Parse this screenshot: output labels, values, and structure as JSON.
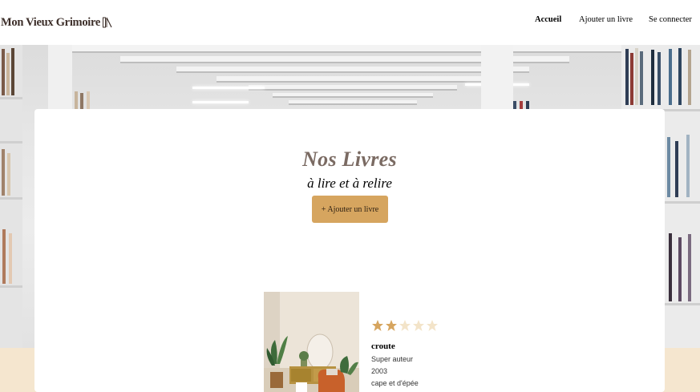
{
  "header": {
    "logo_text": "Mon Vieux Grimoire",
    "nav": {
      "home": "Accueil",
      "add_book": "Ajouter un livre",
      "login": "Se connecter"
    }
  },
  "hero": {
    "title": "Nos Livres",
    "subtitle": "à lire et à relire",
    "add_button": "+ Ajouter un livre"
  },
  "books": [
    {
      "title": "croute",
      "author": "Super auteur",
      "year": "2003",
      "genre": "cape et d'épée",
      "rating": 2,
      "max_rating": 5
    }
  ],
  "colors": {
    "accent": "#d6a55f",
    "star_filled": "#d6a55f",
    "star_empty": "#f3e4c9",
    "title_color": "#7a6a62"
  }
}
